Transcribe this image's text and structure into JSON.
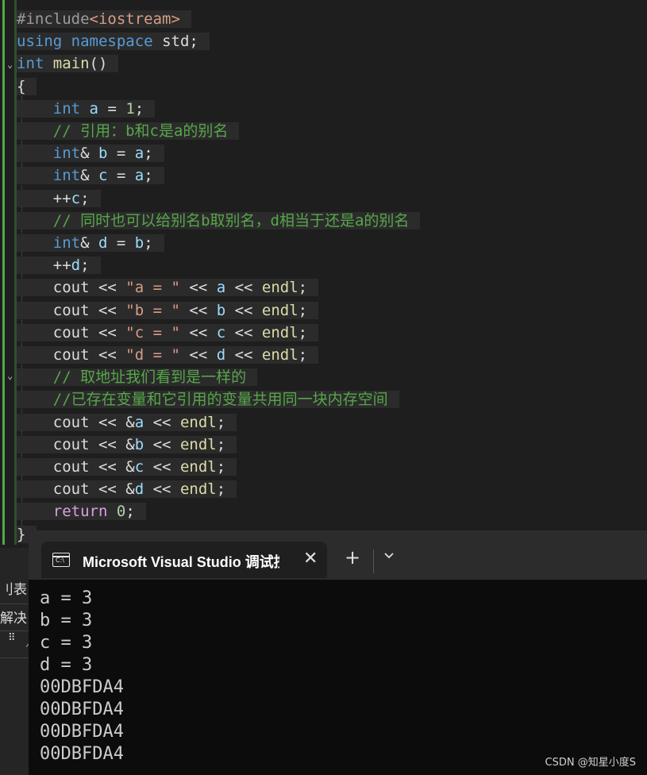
{
  "editor": {
    "lines": [
      [
        {
          "c": "pp",
          "t": "#include"
        },
        {
          "c": "inc",
          "t": "<iostream>"
        }
      ],
      [
        {
          "c": "kw",
          "t": "using"
        },
        {
          "c": "ws",
          "t": " "
        },
        {
          "c": "kw",
          "t": "namespace"
        },
        {
          "c": "ws",
          "t": " "
        },
        {
          "c": "tx",
          "t": "std;"
        }
      ],
      [
        {
          "c": "kw",
          "t": "int"
        },
        {
          "c": "ws",
          "t": " "
        },
        {
          "c": "fn",
          "t": "main"
        },
        {
          "c": "tx",
          "t": "()"
        }
      ],
      [
        {
          "c": "tx",
          "t": "{"
        }
      ],
      [
        {
          "c": "ws",
          "t": "    "
        },
        {
          "c": "kw",
          "t": "int"
        },
        {
          "c": "ws",
          "t": " "
        },
        {
          "c": "var",
          "t": "a"
        },
        {
          "c": "tx",
          "t": " = "
        },
        {
          "c": "num",
          "t": "1"
        },
        {
          "c": "tx",
          "t": ";"
        }
      ],
      [
        {
          "c": "ws",
          "t": "    "
        },
        {
          "c": "cm",
          "t": "// 引用：b和c是a的别名"
        }
      ],
      [
        {
          "c": "ws",
          "t": "    "
        },
        {
          "c": "kw",
          "t": "int"
        },
        {
          "c": "tx",
          "t": "& "
        },
        {
          "c": "var",
          "t": "b"
        },
        {
          "c": "tx",
          "t": " = "
        },
        {
          "c": "var",
          "t": "a"
        },
        {
          "c": "tx",
          "t": ";"
        }
      ],
      [
        {
          "c": "ws",
          "t": "    "
        },
        {
          "c": "kw",
          "t": "int"
        },
        {
          "c": "tx",
          "t": "& "
        },
        {
          "c": "var",
          "t": "c"
        },
        {
          "c": "tx",
          "t": " = "
        },
        {
          "c": "var",
          "t": "a"
        },
        {
          "c": "tx",
          "t": ";"
        }
      ],
      [
        {
          "c": "ws",
          "t": "    "
        },
        {
          "c": "tx",
          "t": "++"
        },
        {
          "c": "var",
          "t": "c"
        },
        {
          "c": "tx",
          "t": ";"
        }
      ],
      [
        {
          "c": "ws",
          "t": "    "
        },
        {
          "c": "cm",
          "t": "// 同时也可以给别名b取别名，d相当于还是a的别名"
        }
      ],
      [
        {
          "c": "ws",
          "t": "    "
        },
        {
          "c": "kw",
          "t": "int"
        },
        {
          "c": "tx",
          "t": "& "
        },
        {
          "c": "var",
          "t": "d"
        },
        {
          "c": "tx",
          "t": " = "
        },
        {
          "c": "var",
          "t": "b"
        },
        {
          "c": "tx",
          "t": ";"
        }
      ],
      [
        {
          "c": "ws",
          "t": "    "
        },
        {
          "c": "tx",
          "t": "++"
        },
        {
          "c": "var",
          "t": "d"
        },
        {
          "c": "tx",
          "t": ";"
        }
      ],
      [
        {
          "c": "ws",
          "t": "    "
        },
        {
          "c": "tx",
          "t": "cout << "
        },
        {
          "c": "str",
          "t": "\"a = \""
        },
        {
          "c": "tx",
          "t": " << "
        },
        {
          "c": "var",
          "t": "a"
        },
        {
          "c": "tx",
          "t": " << "
        },
        {
          "c": "fn",
          "t": "endl"
        },
        {
          "c": "tx",
          "t": ";"
        }
      ],
      [
        {
          "c": "ws",
          "t": "    "
        },
        {
          "c": "tx",
          "t": "cout << "
        },
        {
          "c": "str",
          "t": "\"b = \""
        },
        {
          "c": "tx",
          "t": " << "
        },
        {
          "c": "var",
          "t": "b"
        },
        {
          "c": "tx",
          "t": " << "
        },
        {
          "c": "fn",
          "t": "endl"
        },
        {
          "c": "tx",
          "t": ";"
        }
      ],
      [
        {
          "c": "ws",
          "t": "    "
        },
        {
          "c": "tx",
          "t": "cout << "
        },
        {
          "c": "str",
          "t": "\"c = \""
        },
        {
          "c": "tx",
          "t": " << "
        },
        {
          "c": "var",
          "t": "c"
        },
        {
          "c": "tx",
          "t": " << "
        },
        {
          "c": "fn",
          "t": "endl"
        },
        {
          "c": "tx",
          "t": ";"
        }
      ],
      [
        {
          "c": "ws",
          "t": "    "
        },
        {
          "c": "tx",
          "t": "cout << "
        },
        {
          "c": "str",
          "t": "\"d = \""
        },
        {
          "c": "tx",
          "t": " << "
        },
        {
          "c": "var",
          "t": "d"
        },
        {
          "c": "tx",
          "t": " << "
        },
        {
          "c": "fn",
          "t": "endl"
        },
        {
          "c": "tx",
          "t": ";"
        }
      ],
      [
        {
          "c": "ws",
          "t": "    "
        },
        {
          "c": "cm",
          "t": "// 取地址我们看到是一样的"
        }
      ],
      [
        {
          "c": "ws",
          "t": "    "
        },
        {
          "c": "cm",
          "t": "//已存在变量和它引用的变量共用同一块内存空间"
        }
      ],
      [
        {
          "c": "ws",
          "t": "    "
        },
        {
          "c": "tx",
          "t": "cout << &"
        },
        {
          "c": "var",
          "t": "a"
        },
        {
          "c": "tx",
          "t": " << "
        },
        {
          "c": "fn",
          "t": "endl"
        },
        {
          "c": "tx",
          "t": ";"
        }
      ],
      [
        {
          "c": "ws",
          "t": "    "
        },
        {
          "c": "tx",
          "t": "cout << &"
        },
        {
          "c": "var",
          "t": "b"
        },
        {
          "c": "tx",
          "t": " << "
        },
        {
          "c": "fn",
          "t": "endl"
        },
        {
          "c": "tx",
          "t": ";"
        }
      ],
      [
        {
          "c": "ws",
          "t": "    "
        },
        {
          "c": "tx",
          "t": "cout << &"
        },
        {
          "c": "var",
          "t": "c"
        },
        {
          "c": "tx",
          "t": " << "
        },
        {
          "c": "fn",
          "t": "endl"
        },
        {
          "c": "tx",
          "t": ";"
        }
      ],
      [
        {
          "c": "ws",
          "t": "    "
        },
        {
          "c": "tx",
          "t": "cout << &"
        },
        {
          "c": "var",
          "t": "d"
        },
        {
          "c": "tx",
          "t": " << "
        },
        {
          "c": "fn",
          "t": "endl"
        },
        {
          "c": "tx",
          "t": ";"
        }
      ],
      [
        {
          "c": "ws",
          "t": "    "
        },
        {
          "c": "ctl",
          "t": "return"
        },
        {
          "c": "tx",
          "t": " "
        },
        {
          "c": "num",
          "t": "0"
        },
        {
          "c": "tx",
          "t": ";"
        }
      ],
      [
        {
          "c": "tx",
          "t": "}"
        }
      ]
    ]
  },
  "left_panel": {
    "item1": "刂表",
    "item2": "解决",
    "item3": "⠿",
    "item4": "亻"
  },
  "terminal": {
    "tab_title": "Microsoft Visual Studio 调试控制台",
    "close_glyph": "✕",
    "new_tab_glyph": "+",
    "output": [
      "a = 3",
      "b = 3",
      "c = 3",
      "d = 3",
      "00DBFDA4",
      "00DBFDA4",
      "00DBFDA4",
      "00DBFDA4"
    ]
  },
  "watermark": "CSDN @知星小度S",
  "colors": {
    "gutter_green": "#57a64a",
    "editor_bg": "#1e1e1e",
    "terminal_bg": "#0c0c0c"
  }
}
